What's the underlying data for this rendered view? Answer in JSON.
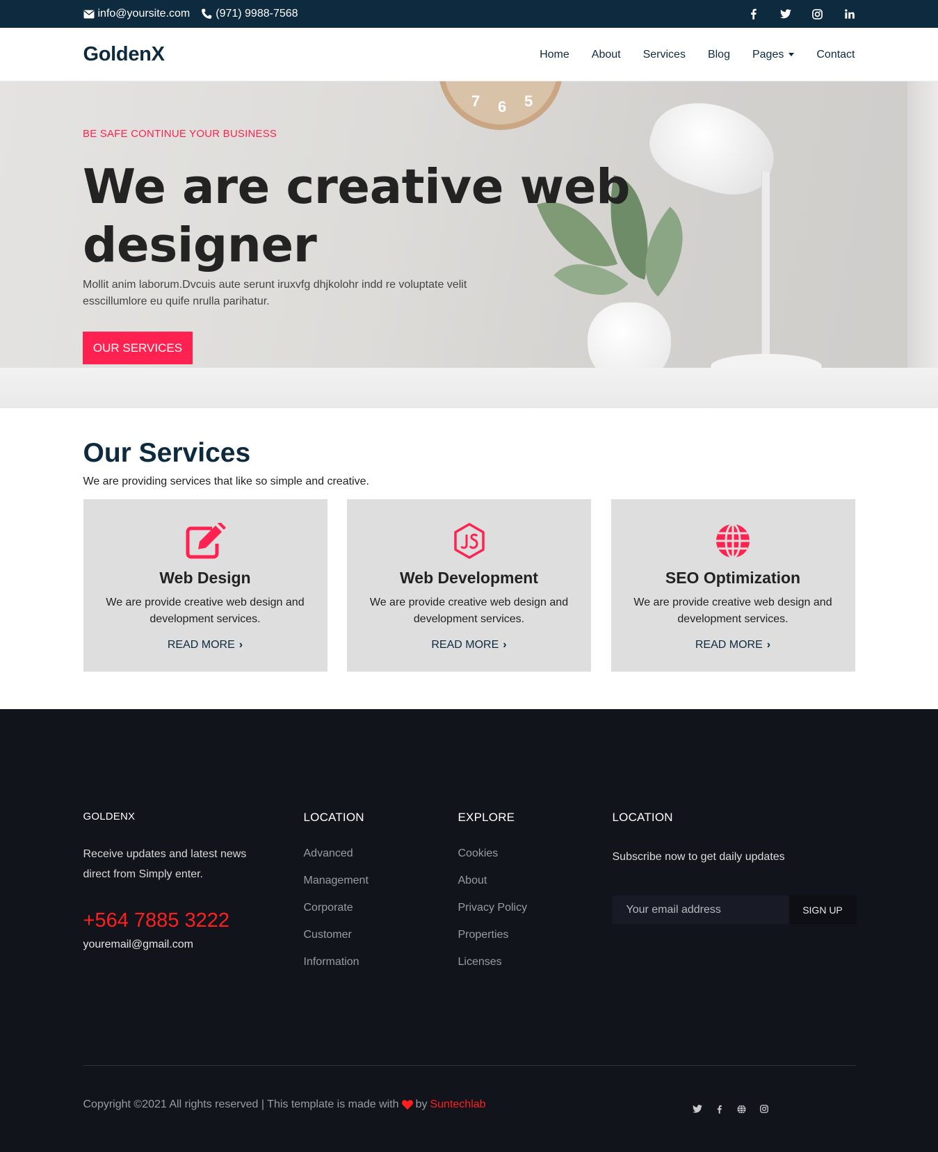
{
  "topbar": {
    "email": "info@yoursite.com",
    "phone": "(971) 9988-7568",
    "socials": [
      "facebook-icon",
      "twitter-icon",
      "instagram-icon",
      "linkedin-icon"
    ]
  },
  "navbar": {
    "brand": "GoldenX",
    "items": [
      {
        "label": "Home"
      },
      {
        "label": "About"
      },
      {
        "label": "Services"
      },
      {
        "label": "Blog"
      },
      {
        "label": "Pages"
      },
      {
        "label": "Contact"
      }
    ]
  },
  "hero": {
    "kicker": "BE SAFE CONTINUE YOUR BUSINESS",
    "title": "We are creative web designer",
    "lead": "Mollit anim laborum.Dvcuis aute serunt iruxvfg dhjkolohr indd re voluptate velit esscillumlore eu quife nrulla parihatur.",
    "button": "OUR SERVICES",
    "clock_numbers": [
      "7",
      "6",
      "5"
    ]
  },
  "services": {
    "heading": "Our Services",
    "subheading": "We are providing services that like so simple and creative.",
    "cards": [
      {
        "icon": "edit-icon",
        "title": "Web Design",
        "text": "We are provide creative web design and development services.",
        "link": "READ MORE"
      },
      {
        "icon": "js-icon",
        "title": "Web Development",
        "text": "We are provide creative web design and development services.",
        "link": "READ MORE"
      },
      {
        "icon": "globe-icon",
        "title": "SEO Optimization",
        "text": "We are provide creative web design and development services.",
        "link": "READ MORE"
      }
    ]
  },
  "footer": {
    "brand": {
      "title": "GOLDENX",
      "text": "Receive updates and latest news direct from Simply enter.",
      "phone": "+564 7885 3222",
      "email": "youremail@gmail.com"
    },
    "location": {
      "title": "LOCATION",
      "links": [
        "Advanced",
        "Management",
        "Corporate",
        "Customer",
        "Information"
      ]
    },
    "explore": {
      "title": "EXPLORE",
      "links": [
        "Cookies",
        "About",
        "Privacy Policy",
        "Properties",
        "Licenses"
      ]
    },
    "newsletter": {
      "title": "LOCATION",
      "text": "Subscribe now to get daily updates",
      "placeholder": "Your email address",
      "button": "SIGN UP"
    },
    "copyright": {
      "prefix": "Copyright ©2021 All rights reserved | This template is made with",
      "by": "by",
      "author": "Suntechlab"
    },
    "socials": [
      "twitter-icon",
      "facebook-icon",
      "globe-icon",
      "instagram-icon"
    ]
  },
  "colors": {
    "accent": "#ff2250",
    "navy": "#0e2a3f",
    "footer_bg": "#12141c",
    "phone_red": "#ff1f1f"
  }
}
